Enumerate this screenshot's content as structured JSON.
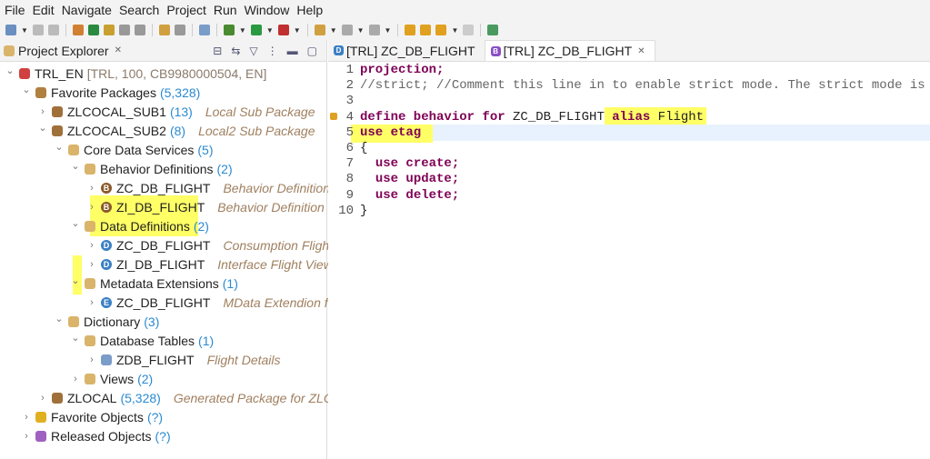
{
  "menu": [
    "File",
    "Edit",
    "Navigate",
    "Search",
    "Project",
    "Run",
    "Window",
    "Help"
  ],
  "explorer": {
    "title": "Project Explorer",
    "rows": [
      {
        "level": 0,
        "exp": "down",
        "icon": "project-icon",
        "color": "#d04040",
        "label": "TRL_EN",
        "count": "",
        "desc": "",
        "extra": "[TRL, 100, CB9980000504, EN]"
      },
      {
        "level": 1,
        "exp": "down",
        "icon": "favorite-packages-icon",
        "color": "#b08040",
        "label": "Favorite Packages",
        "count": "(5,328)",
        "desc": ""
      },
      {
        "level": 2,
        "exp": "right",
        "icon": "package-icon",
        "color": "#a0703a",
        "label": "ZLCOCAL_SUB1",
        "count": "(13)",
        "desc": "Local Sub Package"
      },
      {
        "level": 2,
        "exp": "down",
        "icon": "package-icon",
        "color": "#a0703a",
        "label": "ZLCOCAL_SUB2",
        "count": "(8)",
        "desc": "Local2 Sub Package"
      },
      {
        "level": 3,
        "exp": "down",
        "icon": "folder-icon",
        "color": "#d9b46a",
        "label": "Core Data Services",
        "count": "(5)",
        "desc": ""
      },
      {
        "level": 4,
        "exp": "down",
        "icon": "folder-icon",
        "color": "#d9b46a",
        "label": "Behavior Definitions",
        "count": "(2)",
        "desc": ""
      },
      {
        "level": 5,
        "exp": "right",
        "icon": "behavior-definition-icon",
        "color": "#8a5a2a",
        "glyph": "B",
        "label": "ZC_DB_FLIGHT",
        "count": "",
        "desc": "Behavior Definition for"
      },
      {
        "level": 5,
        "exp": "right",
        "icon": "behavior-definition-icon",
        "color": "#8a5a2a",
        "glyph": "B",
        "label": "ZI_DB_FLIGHT",
        "count": "",
        "desc": "Behavior Definition for I"
      },
      {
        "level": 4,
        "exp": "down",
        "icon": "folder-icon",
        "color": "#d9b46a",
        "label": "Data Definitions",
        "count": "(2)",
        "desc": ""
      },
      {
        "level": 5,
        "exp": "right",
        "icon": "data-definition-icon",
        "color": "#3b7fc4",
        "glyph": "D",
        "label": "ZC_DB_FLIGHT",
        "count": "",
        "desc": "Consumption Flight De"
      },
      {
        "level": 5,
        "exp": "right",
        "icon": "data-definition-icon",
        "color": "#3b7fc4",
        "glyph": "D",
        "label": "ZI_DB_FLIGHT",
        "count": "",
        "desc": "Interface Flight View"
      },
      {
        "level": 4,
        "exp": "down",
        "icon": "folder-icon",
        "color": "#d9b46a",
        "label": "Metadata Extensions",
        "count": "(1)",
        "desc": ""
      },
      {
        "level": 5,
        "exp": "right",
        "icon": "metadata-extension-icon",
        "color": "#3b7fc4",
        "glyph": "E",
        "label": "ZC_DB_FLIGHT",
        "count": "",
        "desc": "MData Extendion for Fl"
      },
      {
        "level": 3,
        "exp": "down",
        "icon": "folder-icon",
        "color": "#d9b46a",
        "label": "Dictionary",
        "count": "(3)",
        "desc": ""
      },
      {
        "level": 4,
        "exp": "down",
        "icon": "folder-icon",
        "color": "#d9b46a",
        "label": "Database Tables",
        "count": "(1)",
        "desc": ""
      },
      {
        "level": 5,
        "exp": "right",
        "icon": "table-icon",
        "color": "#7a9cc8",
        "label": "ZDB_FLIGHT",
        "count": "",
        "desc": "Flight Details"
      },
      {
        "level": 4,
        "exp": "right",
        "icon": "folder-icon",
        "color": "#d9b46a",
        "label": "Views",
        "count": "(2)",
        "desc": ""
      },
      {
        "level": 2,
        "exp": "right",
        "icon": "package-icon",
        "color": "#a0703a",
        "label": "ZLOCAL",
        "count": "(5,328)",
        "desc": "Generated Package for ZLOCAL"
      },
      {
        "level": 1,
        "exp": "right",
        "icon": "star-icon",
        "color": "#e0b020",
        "label": "Favorite Objects",
        "count": "(?)",
        "desc": ""
      },
      {
        "level": 1,
        "exp": "right",
        "icon": "released-objects-icon",
        "color": "#a060c0",
        "label": "Released Objects",
        "count": "(?)",
        "desc": ""
      }
    ]
  },
  "editor": {
    "tabs": [
      {
        "label": "[TRL] ZC_DB_FLIGHT",
        "glyph": "D",
        "color": "#3b7fc4"
      },
      {
        "label": "[TRL] ZC_DB_FLIGHT",
        "glyph": "B",
        "color": "#8a4fc4"
      }
    ],
    "lines": [
      [
        [
          "kw",
          "projection;"
        ]
      ],
      [
        [
          "cm",
          "//strict; //Comment this line in to enable strict mode. The strict mode is p"
        ]
      ],
      [],
      [
        [
          "kw",
          "define behavior for "
        ],
        [
          "",
          "ZC_DB_FLIGHT "
        ],
        [
          "kw",
          "alias"
        ],
        [
          "",
          " Flight"
        ]
      ],
      [
        [
          "kw",
          "use etag"
        ]
      ],
      [
        [
          "",
          "{"
        ]
      ],
      [
        [
          "",
          "  "
        ],
        [
          "kw",
          "use create;"
        ]
      ],
      [
        [
          "",
          "  "
        ],
        [
          "kw",
          "use update;"
        ]
      ],
      [
        [
          "",
          "  "
        ],
        [
          "kw",
          "use delete;"
        ]
      ],
      [
        [
          "",
          "}"
        ]
      ]
    ]
  },
  "colors": {
    "highlight": "#ffff66",
    "keyword": "#7f0055",
    "count": "#2a8ad0",
    "description": "#a08060"
  }
}
